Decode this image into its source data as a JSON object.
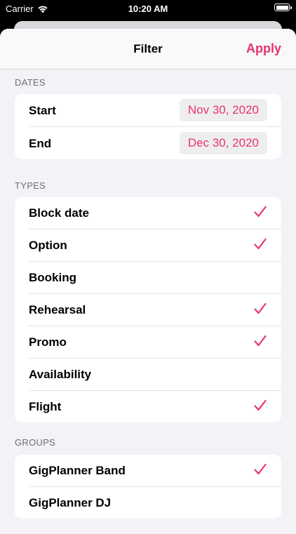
{
  "status_bar": {
    "carrier": "Carrier",
    "time": "10:20 AM"
  },
  "nav": {
    "title": "Filter",
    "apply": "Apply"
  },
  "accent_color": "#e8336b",
  "dates": {
    "header": "DATES",
    "start": {
      "label": "Start",
      "value": "Nov 30, 2020"
    },
    "end": {
      "label": "End",
      "value": "Dec 30, 2020"
    }
  },
  "types": {
    "header": "TYPES",
    "items": [
      {
        "label": "Block date",
        "checked": true
      },
      {
        "label": "Option",
        "checked": true
      },
      {
        "label": "Booking",
        "checked": false
      },
      {
        "label": "Rehearsal",
        "checked": true
      },
      {
        "label": "Promo",
        "checked": true
      },
      {
        "label": "Availability",
        "checked": false
      },
      {
        "label": "Flight",
        "checked": true
      }
    ]
  },
  "groups": {
    "header": "GROUPS",
    "items": [
      {
        "label": "GigPlanner Band",
        "checked": true
      },
      {
        "label": "GigPlanner DJ",
        "checked": false
      }
    ]
  }
}
